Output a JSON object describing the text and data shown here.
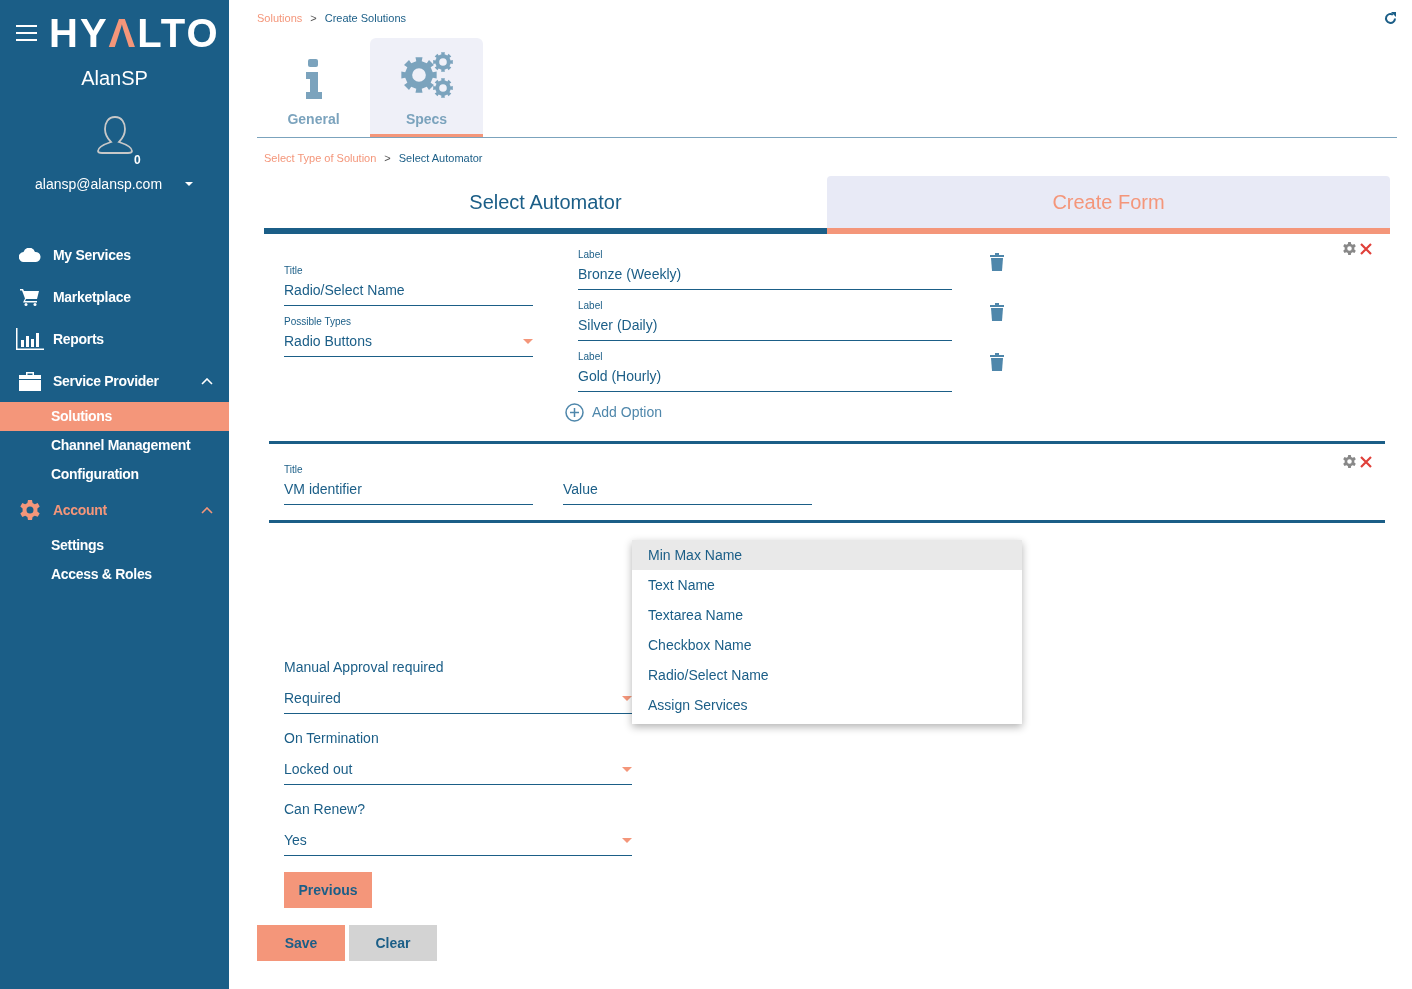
{
  "sidebar": {
    "logo": {
      "parts": [
        "HY",
        "Λ",
        "LTO"
      ]
    },
    "user": {
      "name": "AlanSP",
      "badge": "0",
      "email": "alansp@alansp.com"
    },
    "nav": [
      {
        "label": "My Services",
        "active": false
      },
      {
        "label": "Marketplace",
        "active": false
      },
      {
        "label": "Reports",
        "active": false
      },
      {
        "label": "Service Provider",
        "active": false,
        "expanded": true,
        "children": [
          {
            "label": "Solutions",
            "selected": true
          },
          {
            "label": "Channel Management",
            "selected": false
          },
          {
            "label": "Configuration",
            "selected": false
          }
        ]
      },
      {
        "label": "Account",
        "active": true,
        "expanded": true,
        "children": [
          {
            "label": "Settings",
            "selected": false
          },
          {
            "label": "Access & Roles",
            "selected": false
          }
        ]
      }
    ]
  },
  "breadcrumb": {
    "separator": ">",
    "items": [
      "Solutions",
      "Create Solutions"
    ]
  },
  "tabs": [
    {
      "label": "General",
      "selected": false
    },
    {
      "label": "Specs",
      "selected": true
    }
  ],
  "sub_breadcrumb": {
    "separator": ">",
    "items": [
      "Select Type of Solution",
      "Select Automator"
    ]
  },
  "steps": [
    {
      "label": "Select Automator",
      "selected": false
    },
    {
      "label": "Create Form",
      "selected": true
    }
  ],
  "form_cards": [
    {
      "kind": "options",
      "title": {
        "label": "Title",
        "value": "Radio/Select Name"
      },
      "type": {
        "label": "Possible Types",
        "value": "Radio Buttons"
      },
      "options": [
        {
          "label": "Label",
          "value": "Bronze (Weekly)"
        },
        {
          "label": "Label",
          "value": "Silver (Daily)"
        },
        {
          "label": "Label",
          "value": "Gold (Hourly)"
        }
      ],
      "add_option": "Add Option"
    },
    {
      "kind": "text",
      "title": {
        "label": "Title",
        "value": "VM identifier"
      },
      "value_field": {
        "placeholder": "Value"
      }
    }
  ],
  "field_menu": [
    {
      "label": "Min Max Name",
      "selected": true
    },
    {
      "label": "Text Name",
      "selected": false
    },
    {
      "label": "Textarea Name",
      "selected": false
    },
    {
      "label": "Checkbox Name",
      "selected": false
    },
    {
      "label": "Radio/Select Name",
      "selected": false
    },
    {
      "label": "Assign Services",
      "selected": false
    }
  ],
  "settings": [
    {
      "label": "Manual Approval required",
      "value": "Required"
    },
    {
      "label": "On Termination",
      "value": "Locked out"
    },
    {
      "label": "Can Renew?",
      "value": "Yes"
    }
  ],
  "previous_button": "Previous",
  "actions": [
    {
      "label": "Save",
      "kind": "primary"
    },
    {
      "label": "Clear",
      "kind": "secondary"
    }
  ]
}
